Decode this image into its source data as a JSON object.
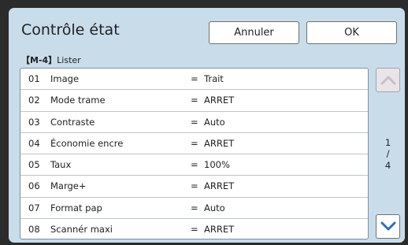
{
  "header": {
    "title": "Contrôle état",
    "cancel_label": "Annuler",
    "ok_label": "OK"
  },
  "section": {
    "mode": "【M-4】",
    "label": "Lister"
  },
  "rows": [
    {
      "num": "01",
      "name": "Image",
      "eq": "=",
      "value": "Trait"
    },
    {
      "num": "02",
      "name": "Mode trame",
      "eq": "=",
      "value": "ARRET"
    },
    {
      "num": "03",
      "name": "Contraste",
      "eq": "=",
      "value": "Auto"
    },
    {
      "num": "04",
      "name": "Économie encre",
      "eq": "=",
      "value": "ARRET"
    },
    {
      "num": "05",
      "name": "Taux",
      "eq": "=",
      "value": "100%"
    },
    {
      "num": "06",
      "name": "Marge+",
      "eq": "=",
      "value": "ARRET"
    },
    {
      "num": "07",
      "name": "Format pap",
      "eq": "=",
      "value": "Auto"
    },
    {
      "num": "08",
      "name": "Scannér maxi",
      "eq": "=",
      "value": "ARRET"
    }
  ],
  "pagination": {
    "current": "1",
    "separator": "/",
    "total": "4"
  },
  "icons": {
    "scroll_up": "chevron-up-icon",
    "scroll_down": "chevron-down-icon"
  },
  "colors": {
    "panel_bg": "#c9dcea",
    "chevron_active": "#2f6fb0",
    "chevron_disabled": "#c7c0c7"
  }
}
